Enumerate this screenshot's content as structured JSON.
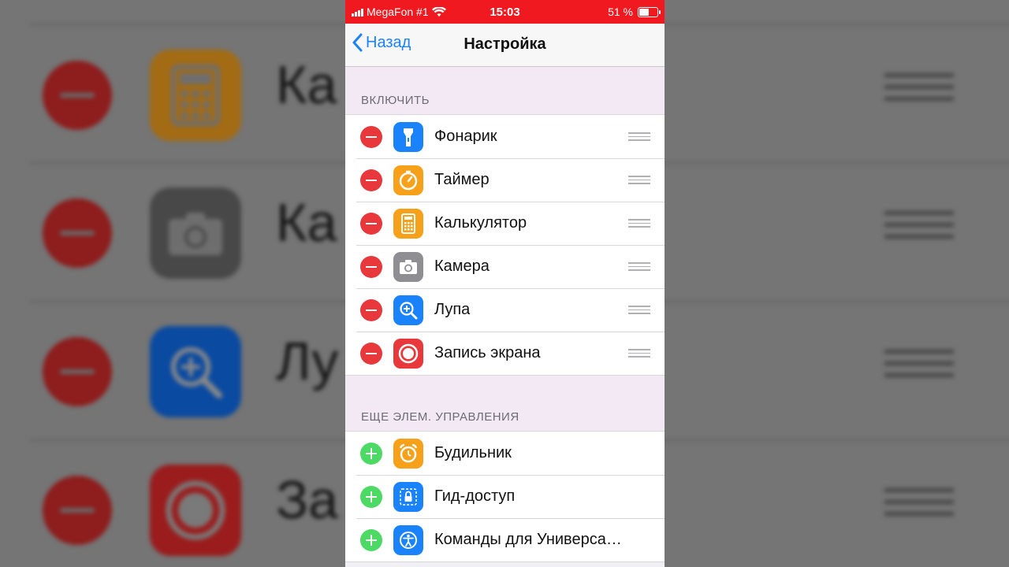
{
  "status_bar": {
    "carrier": "MegaFon #1",
    "time": "15:03",
    "battery": "51 %",
    "battery_level": 0.51,
    "color": "#f0191f"
  },
  "nav": {
    "back_label": "Назад",
    "title": "Настройка"
  },
  "sections": {
    "enabled": {
      "header": "ВКЛЮЧИТЬ",
      "items": [
        {
          "label": "Фонарик",
          "icon": "flashlight-icon",
          "color": "#1a82fb"
        },
        {
          "label": "Таймер",
          "icon": "timer-icon",
          "color": "#f7a11a"
        },
        {
          "label": "Калькулятор",
          "icon": "calculator-icon",
          "color": "#f7a11a"
        },
        {
          "label": "Камера",
          "icon": "camera-icon",
          "color": "#8e8e93"
        },
        {
          "label": "Лупа",
          "icon": "magnifier-icon",
          "color": "#1a82fb"
        },
        {
          "label": "Запись экрана",
          "icon": "screen-record-icon",
          "color": "#e8383b"
        }
      ]
    },
    "more": {
      "header": "ЕЩЕ ЭЛЕМ. УПРАВЛЕНИЯ",
      "items": [
        {
          "label": "Будильник",
          "icon": "alarm-icon",
          "color": "#f7a11a"
        },
        {
          "label": "Гид-доступ",
          "icon": "guided-access-icon",
          "color": "#1a82fb"
        },
        {
          "label": "Команды для Универса…",
          "icon": "accessibility-icon",
          "color": "#1a82fb"
        }
      ]
    }
  },
  "background_text": [
    "Ка",
    "Ка",
    "Лу",
    "За"
  ]
}
